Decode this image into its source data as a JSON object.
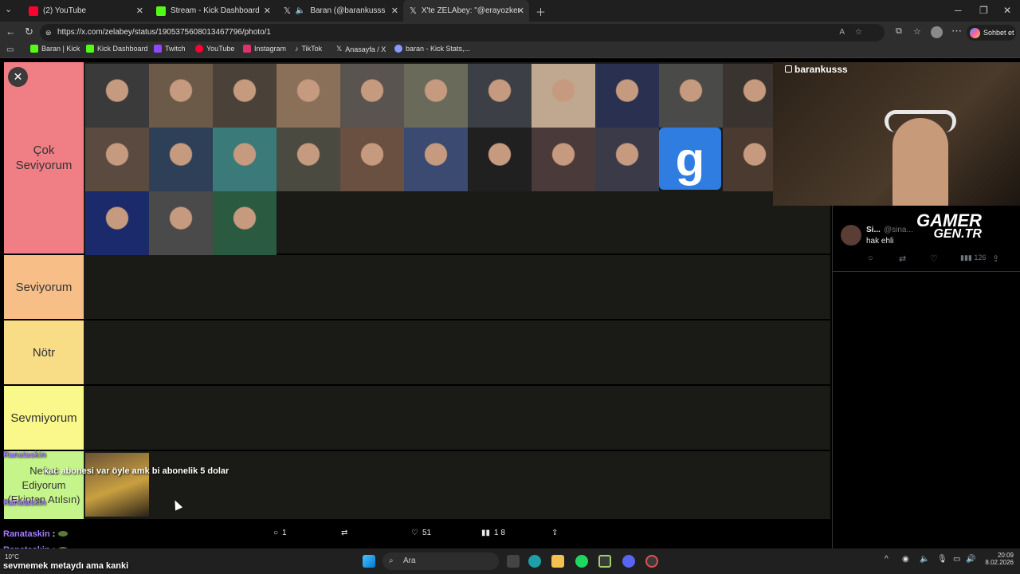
{
  "tabs": [
    {
      "label": "(2) YouTube",
      "color": "#ff0033"
    },
    {
      "label": "Stream - Kick Dashboard",
      "color": "#53fc18"
    },
    {
      "label": "Baran (@barankusss) adlı kullanıcı",
      "color": "#cccccc"
    },
    {
      "label": "X'te ZELAbey: \"@erayozkenar Gen...",
      "color": "#cccccc"
    }
  ],
  "address": {
    "url": "https://x.com/zelabey/status/1905375608013467796/photo/1",
    "profile_button": "Sohbet et"
  },
  "bookmarks": [
    {
      "label": "Baran | Kick",
      "color": "#53fc18"
    },
    {
      "label": "Kick Dashboard",
      "color": "#53fc18"
    },
    {
      "label": "Twitch",
      "color": "#9146ff"
    },
    {
      "label": "YouTube",
      "color": "#ff0033"
    },
    {
      "label": "Instagram",
      "color": "#e1306c"
    },
    {
      "label": "TikTok",
      "color": "#eeeeee"
    },
    {
      "label": "Anasayfa / X",
      "color": "#eeeeee"
    },
    {
      "label": "baran - Kick Stats,...",
      "color": "#8899ff"
    }
  ],
  "tiers": [
    {
      "label": "Çok Seviyorum",
      "color": "#f07e85"
    },
    {
      "label": "Seviyorum",
      "color": "#f7bf87"
    },
    {
      "label": "Nötr",
      "color": "#f8dd86"
    },
    {
      "label": "Sevmiyorum",
      "color": "#faf88b"
    },
    {
      "label": "Nefret Ediyorum (Ekipten Atılsın)",
      "color": "#c5f48a"
    }
  ],
  "gaming_icon_letter": "g",
  "stream": {
    "username": "barankusss",
    "overlay_line1": "GAMER",
    "overlay_line2": "GEN.TR"
  },
  "reply": {
    "name": "Si...",
    "handle": "@sina...",
    "text": "hak ehli",
    "views": "126"
  },
  "chat": [
    {
      "user": "Ranataskin",
      "msg": "kac abonesi var öyle amk bi abonelik 5 dolar"
    },
    {
      "user": "Ranataskin",
      "msg": ":"
    },
    {
      "user": "Ranataskin",
      "msg": ":"
    },
    {
      "user": "",
      "msg": "sevmemek metaydı ama kanki"
    }
  ],
  "post_actions": {
    "replies": "1",
    "likes": "51",
    "views": "1 8"
  },
  "taskbar": {
    "search": "Ara",
    "time": "20:09",
    "date": "8.02.2026",
    "weather": "10°C"
  }
}
